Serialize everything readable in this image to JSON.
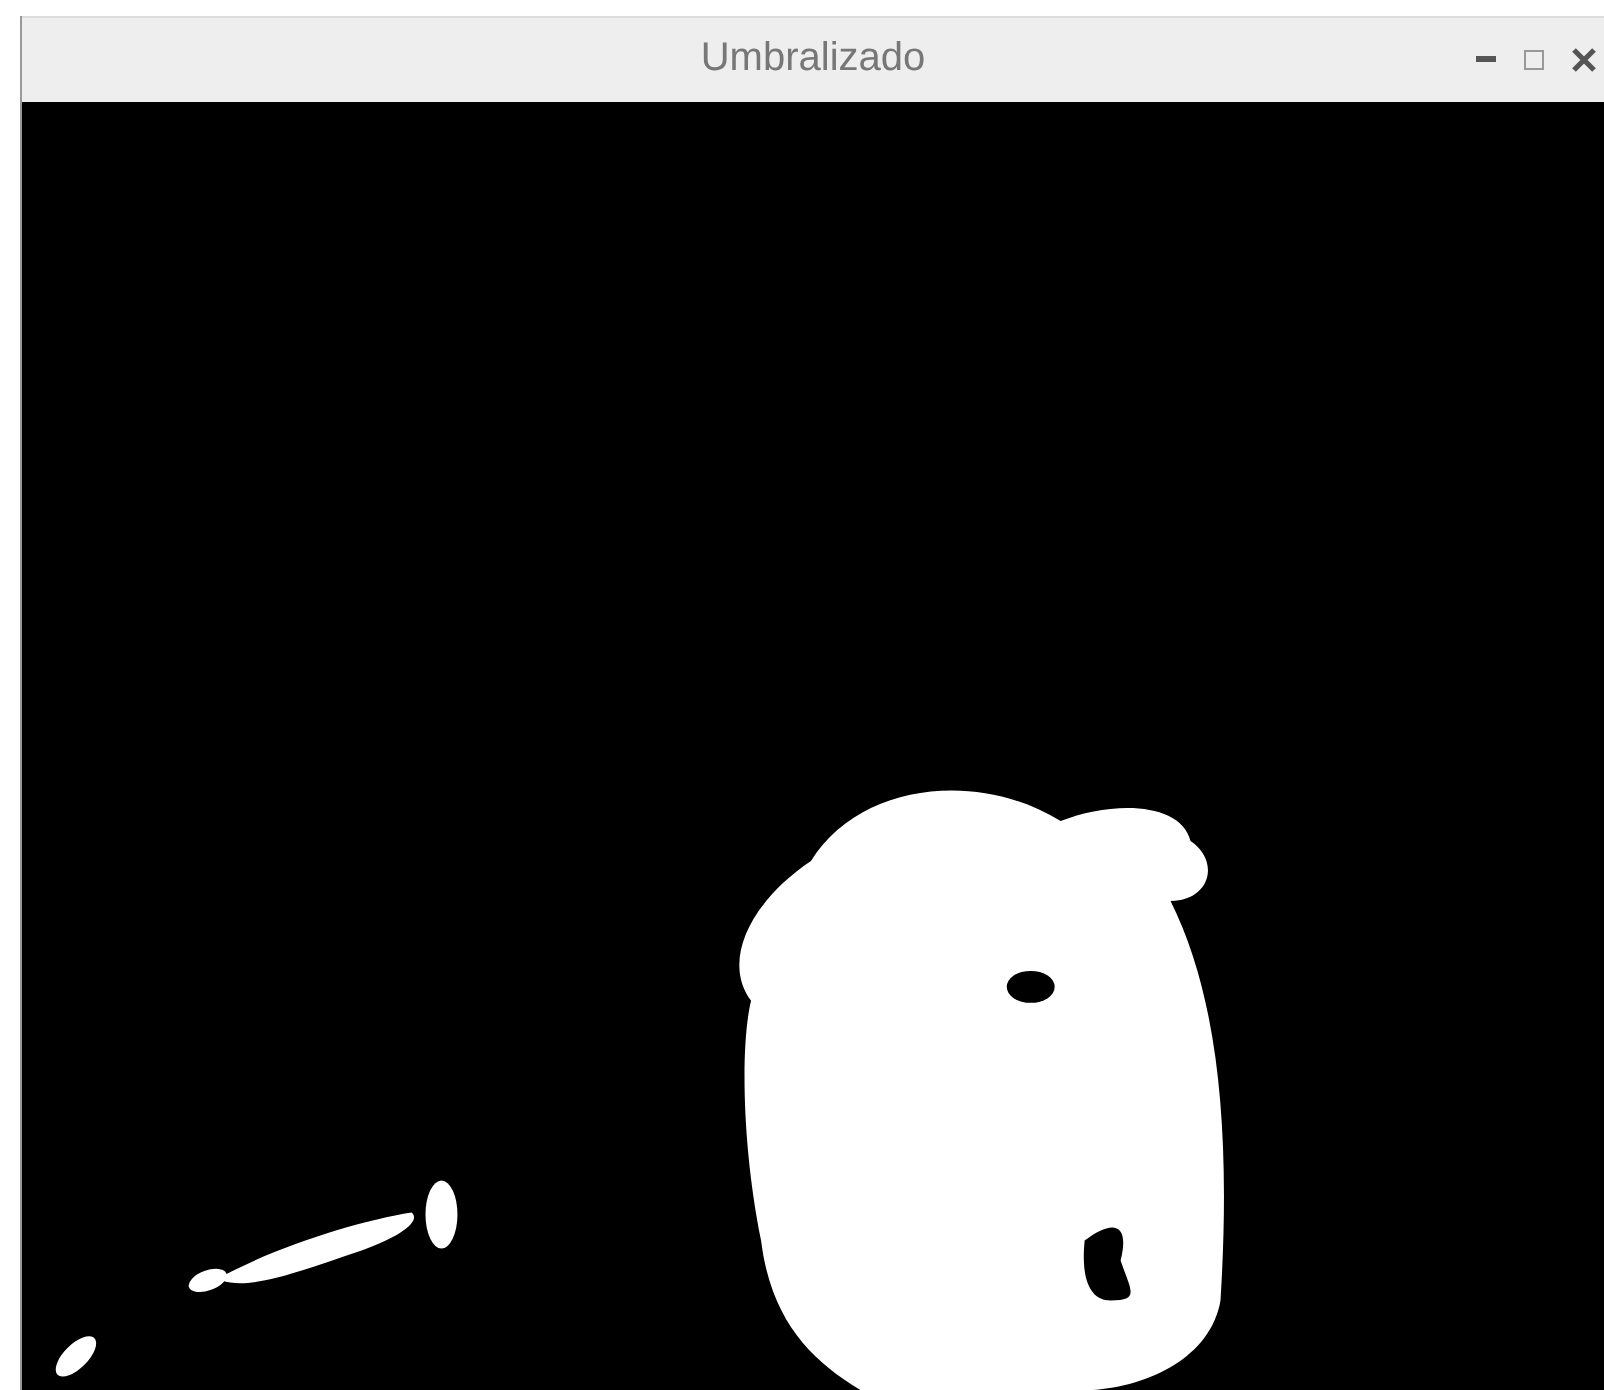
{
  "window": {
    "title": "Umbralizado"
  }
}
